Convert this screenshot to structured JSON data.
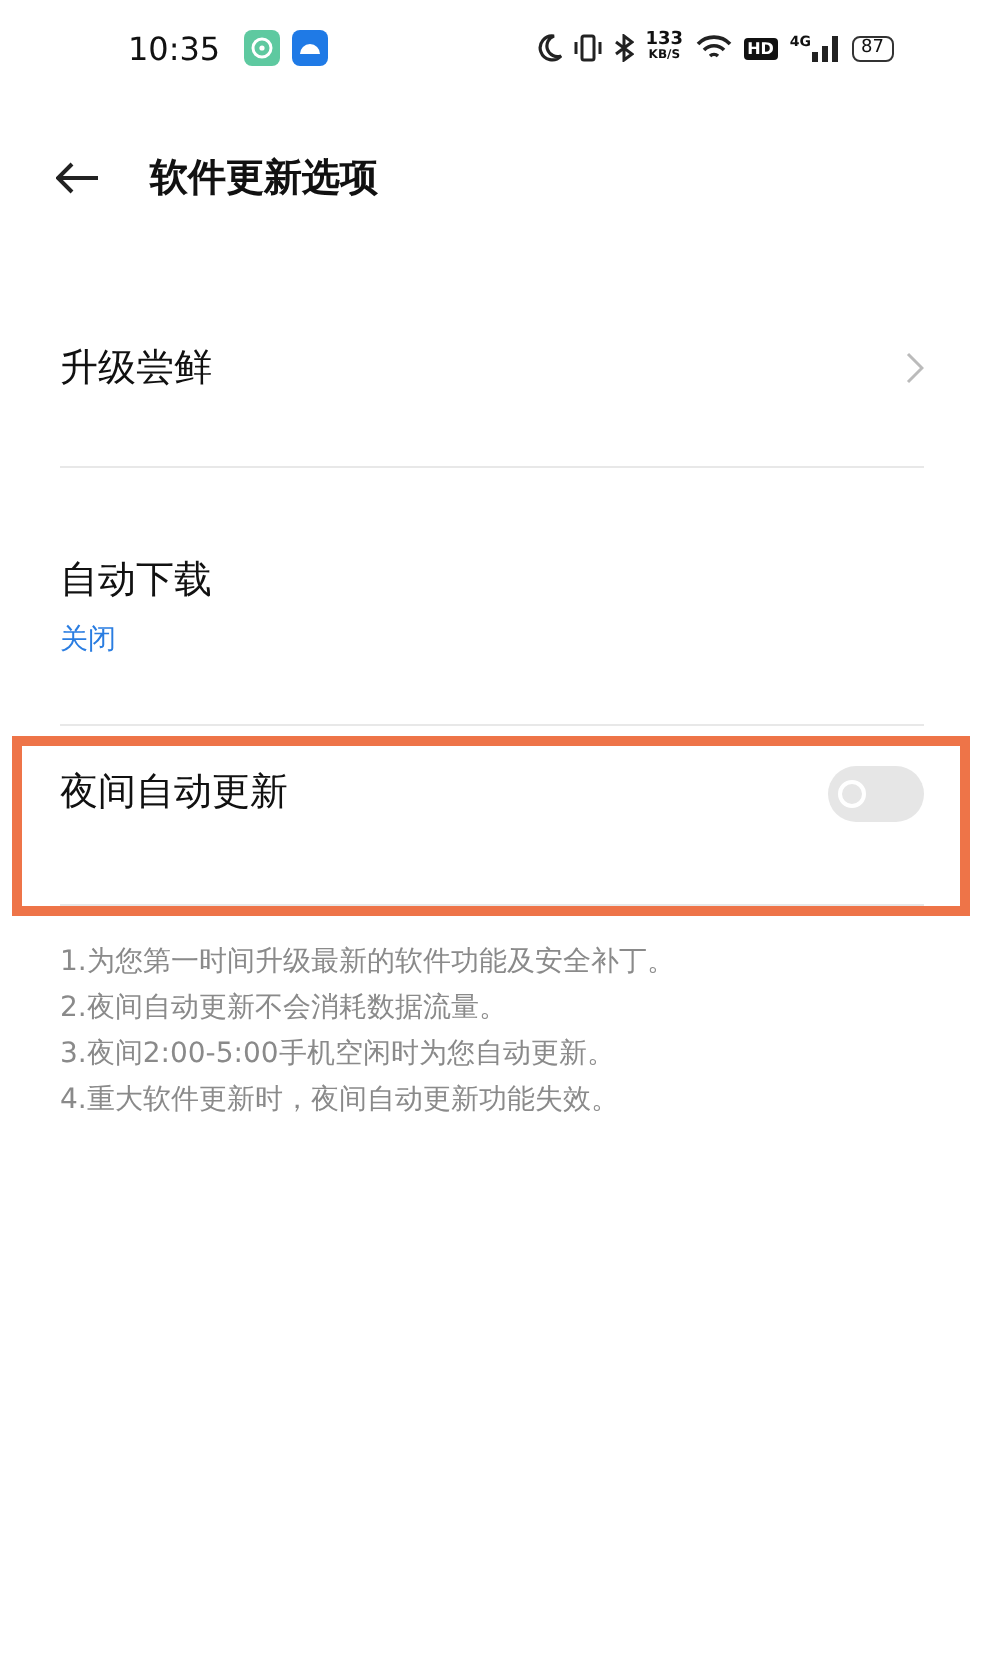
{
  "status_bar": {
    "time": "10:35",
    "speed_value": "133",
    "speed_unit": "KB/S",
    "hd_badge": "HD",
    "network": "4G",
    "battery": "87"
  },
  "header": {
    "title": "软件更新选项"
  },
  "items": [
    {
      "kind": "link",
      "title": "升级尝鲜",
      "highlighted": false
    },
    {
      "kind": "value",
      "title": "自动下载",
      "value": "关闭",
      "highlighted": false
    },
    {
      "kind": "toggle",
      "title": "夜间自动更新",
      "on": false,
      "highlighted": true
    }
  ],
  "notes": [
    "1.为您第一时间升级最新的软件功能及安全补丁。",
    "2.夜间自动更新不会消耗数据流量。",
    "3.夜间2:00-5:00手机空闲时为您自动更新。",
    "4.重大软件更新时，夜间自动更新功能失效。"
  ]
}
